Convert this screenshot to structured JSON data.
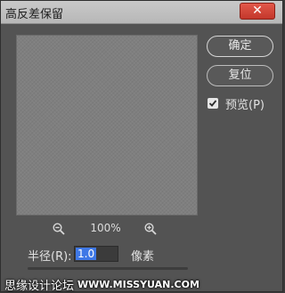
{
  "window": {
    "title": "高反差保留",
    "close_glyph": "✕"
  },
  "buttons": {
    "ok": "确定",
    "reset": "复位"
  },
  "preview_checkbox": {
    "label": "预览(P)",
    "checked": true
  },
  "zoom": {
    "value": "100%",
    "zoom_out_icon": "zoom-out-magnifier",
    "zoom_in_icon": "zoom-in-magnifier"
  },
  "radius": {
    "label": "半径(R):",
    "value": "1.0",
    "unit": "像素"
  },
  "watermark": {
    "text": "思缘设计论坛",
    "url": "WWW.MISSYUAN.COM"
  },
  "colors": {
    "dialog_bg": "#535353",
    "preview_bg": "#7f7f7f",
    "selection": "#3f78e6",
    "close_button": "#d0473a"
  }
}
